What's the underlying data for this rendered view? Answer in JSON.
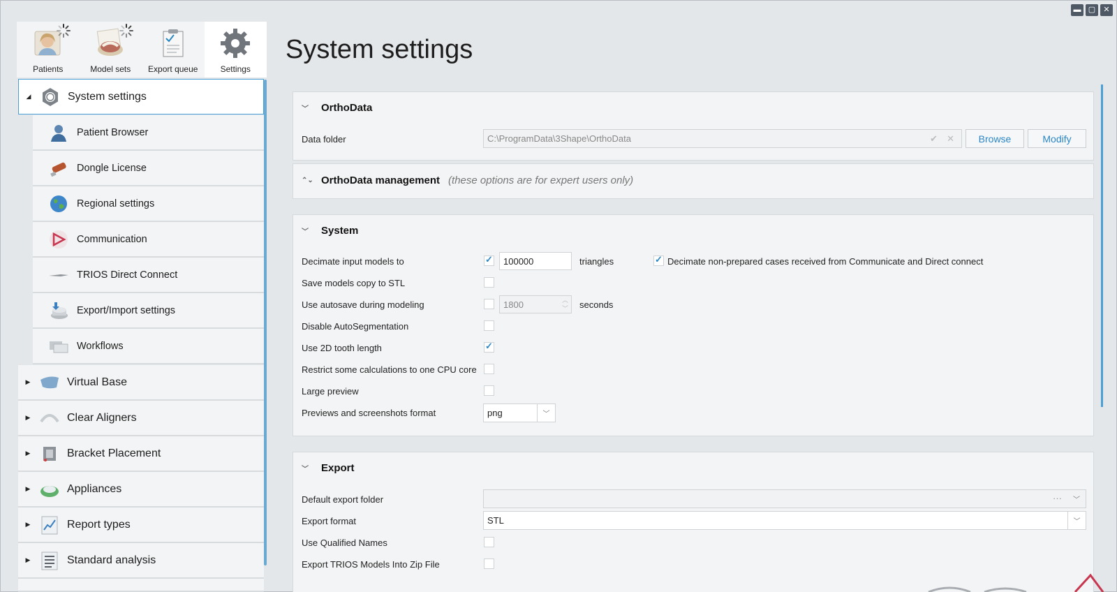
{
  "window": {
    "controls": {
      "minimize": "▬",
      "maximize": "▢",
      "close": "✕"
    }
  },
  "top_tabs": [
    {
      "label": "Patients",
      "icon": "patient-photo-icon",
      "loading": true
    },
    {
      "label": "Model sets",
      "icon": "model-set-icon",
      "loading": true
    },
    {
      "label": "Export queue",
      "icon": "clipboard-icon",
      "loading": false
    },
    {
      "label": "Settings",
      "icon": "gear-icon",
      "loading": false,
      "active": true
    }
  ],
  "sidebar": {
    "items": [
      {
        "label": "System settings",
        "icon": "nut-icon",
        "expanded": true,
        "selected": true
      },
      {
        "label": "Patient Browser",
        "icon": "user-icon"
      },
      {
        "label": "Dongle License",
        "icon": "dongle-icon"
      },
      {
        "label": "Regional settings",
        "icon": "globe-icon"
      },
      {
        "label": "Communication",
        "icon": "communicate-logo-icon"
      },
      {
        "label": "TRIOS Direct Connect",
        "icon": "scanner-wand-icon"
      },
      {
        "label": "Export/Import settings",
        "icon": "disk-export-icon"
      },
      {
        "label": "Workflows",
        "icon": "workflow-icon"
      },
      {
        "label": "Virtual Base",
        "icon": "virtual-base-icon"
      },
      {
        "label": "Clear Aligners",
        "icon": "aligner-icon"
      },
      {
        "label": "Bracket Placement",
        "icon": "bracket-icon"
      },
      {
        "label": "Appliances",
        "icon": "appliance-icon"
      },
      {
        "label": "Report types",
        "icon": "chart-report-icon"
      },
      {
        "label": "Standard analysis",
        "icon": "analysis-list-icon"
      }
    ]
  },
  "main": {
    "title": "System settings",
    "orthodata": {
      "heading": "OrthoData",
      "data_folder_label": "Data folder",
      "data_folder_value": "C:\\ProgramData\\3Shape\\OrthoData",
      "browse_label": "Browse",
      "modify_label": "Modify"
    },
    "orthodata_management": {
      "heading": "OrthoData management",
      "hint": "(these options are for expert users only)"
    },
    "system": {
      "heading": "System",
      "rows": [
        {
          "label": "Decimate input models to",
          "checked": true
        },
        {
          "label": "Save models copy to STL",
          "checked": false
        },
        {
          "label": "Use autosave during modeling",
          "checked": false
        },
        {
          "label": "Disable AutoSegmentation",
          "checked": false
        },
        {
          "label": "Use 2D tooth length",
          "checked": true
        },
        {
          "label": "Restrict some calculations to one CPU core",
          "checked": false
        },
        {
          "label": "Large preview",
          "checked": false
        },
        {
          "label": "Previews and screenshots format"
        }
      ],
      "decimate_value": "100000",
      "decimate_unit": "triangles",
      "decimate_nonprepared_label": "Decimate non-prepared cases received from Communicate and Direct connect",
      "decimate_nonprepared_checked": true,
      "autosave_value": "1800",
      "autosave_unit": "seconds",
      "format_value": "png"
    },
    "export": {
      "heading": "Export",
      "rows": [
        {
          "label": "Default export folder"
        },
        {
          "label": "Export format"
        },
        {
          "label": "Use Qualified Names",
          "checked": false
        },
        {
          "label": "Export TRIOS Models Into Zip File",
          "checked": false
        }
      ],
      "export_folder_value": "",
      "ellipsis": "···",
      "export_format_value": "STL"
    }
  },
  "colors": {
    "accent": "#2a86c4",
    "selection_border": "#4a9fd6",
    "panel_bg": "#f3f4f5",
    "window_bg": "#e4e7ea"
  }
}
